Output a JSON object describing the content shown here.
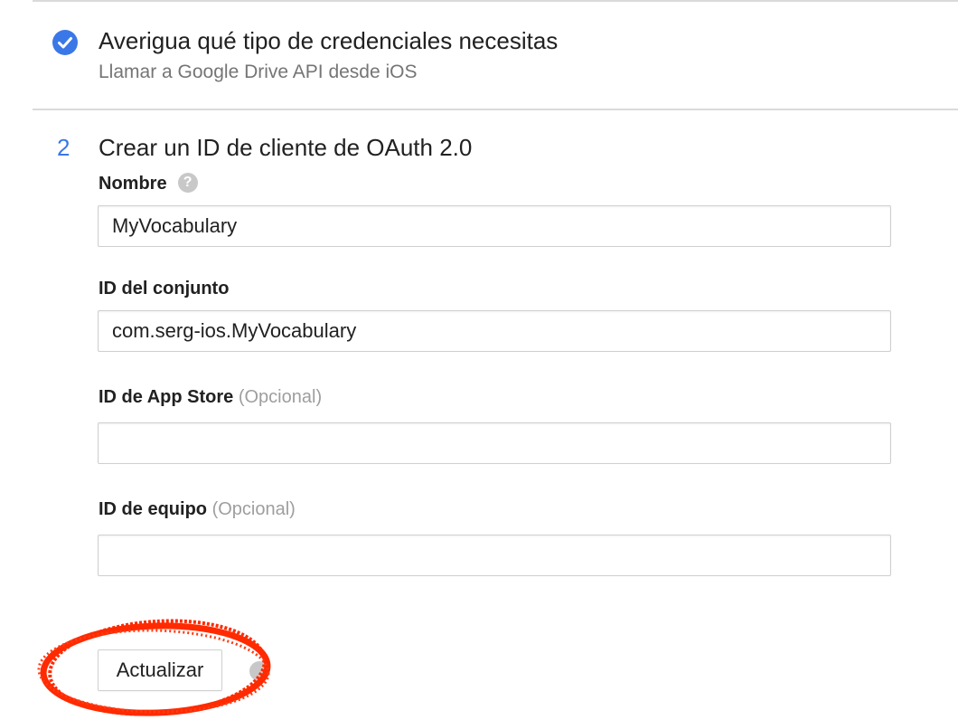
{
  "step1": {
    "title": "Averigua qué tipo de credenciales necesitas",
    "subtitle": "Llamar a Google Drive API desde iOS",
    "icon": "check-circle-icon",
    "icon_color": "#3b78e7"
  },
  "step2": {
    "number": "2",
    "title": "Crear un ID de cliente de OAuth 2.0"
  },
  "form": {
    "name_label": "Nombre",
    "name_help_icon": "help-icon",
    "name_value": "MyVocabulary",
    "bundle_label": "ID del conjunto",
    "bundle_value": "com.serg-ios.MyVocabulary",
    "appstore_label": "ID de App Store",
    "appstore_optional": "(Opcional)",
    "appstore_value": "",
    "team_label": "ID de equipo",
    "team_optional": "(Opcional)",
    "team_value": ""
  },
  "actions": {
    "update_label": "Actualizar",
    "help_icon": "help-icon"
  },
  "annotation": {
    "shape": "hand-drawn-ellipse",
    "color": "#ff2a00"
  },
  "colors": {
    "accent": "#3b78e7",
    "muted_text": "#757575",
    "optional_text": "#9e9e9e",
    "border": "#cfcfcf"
  }
}
